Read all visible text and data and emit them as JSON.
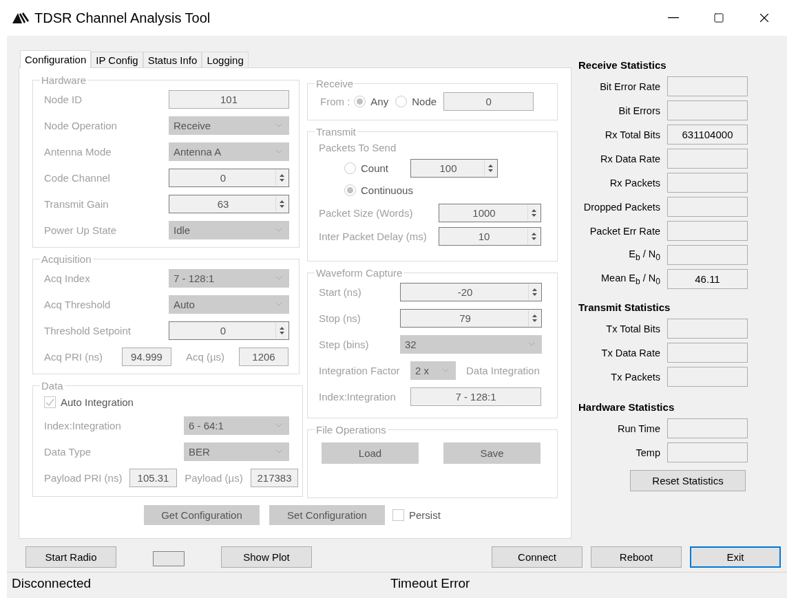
{
  "window": {
    "title": "TDSR Channel Analysis Tool"
  },
  "tabs": [
    {
      "label": "Configuration",
      "selected": true
    },
    {
      "label": "IP Config",
      "selected": false
    },
    {
      "label": "Status Info",
      "selected": false
    },
    {
      "label": "Logging",
      "selected": false
    }
  ],
  "hardware": {
    "title": "Hardware",
    "disabled": true,
    "rows": [
      {
        "kind": "text",
        "label": "Node ID",
        "value": "101"
      },
      {
        "kind": "combo",
        "label": "Node Operation",
        "value": "Receive"
      },
      {
        "kind": "combo",
        "label": "Antenna Mode",
        "value": "Antenna A"
      },
      {
        "kind": "spin",
        "label": "Code Channel",
        "value": "0"
      },
      {
        "kind": "spin",
        "label": "Transmit Gain",
        "value": "63"
      },
      {
        "kind": "combo",
        "label": "Power Up State",
        "value": "Idle"
      }
    ]
  },
  "acquisition": {
    "title": "Acquisition",
    "disabled": true,
    "rows": [
      {
        "kind": "combo",
        "label": "Acq Index",
        "value": "7 - 128:1"
      },
      {
        "kind": "combo",
        "label": "Acq Threshold",
        "value": "Auto"
      },
      {
        "kind": "spin",
        "label": "Threshold Setpoint",
        "value": "0"
      },
      {
        "kind": "pair",
        "label": "Acq PRI (ns)",
        "value": "94.999",
        "label2": "Acq (µs)",
        "value2": "1206"
      }
    ]
  },
  "data": {
    "title": "Data",
    "disabled": true,
    "auto_integration": {
      "label": "Auto Integration",
      "checked": true
    },
    "rows": [
      {
        "kind": "combo",
        "label": "Index:Integration",
        "value": "6 - 64:1"
      },
      {
        "kind": "combo",
        "label": "Data Type",
        "value": "BER"
      },
      {
        "kind": "pair",
        "label": "Payload PRI (ns)",
        "value": "105.31",
        "label2": "Payload (µs)",
        "value2": "217383"
      }
    ]
  },
  "config_buttons": [
    "Get Configuration",
    "Set Configuration"
  ],
  "persist": {
    "label": "Persist",
    "checked": false
  },
  "receive": {
    "title": "Receive",
    "disabled": true,
    "from_label": "From :",
    "options": [
      {
        "label": "Any",
        "selected": true
      },
      {
        "label": "Node",
        "selected": false
      }
    ],
    "node_value": "0"
  },
  "transmit": {
    "title": "Transmit",
    "disabled": true,
    "packets_label": "Packets To Send",
    "count": {
      "label": "Count",
      "selected": false,
      "value": "100"
    },
    "continuous": {
      "label": "Continuous",
      "selected": true
    },
    "rows": [
      {
        "kind": "spin",
        "label": "Packet Size (Words)",
        "value": "1000"
      },
      {
        "kind": "spin",
        "label": "Inter Packet Delay (ms)",
        "value": "10"
      }
    ]
  },
  "waveform_capture": {
    "title": "Waveform Capture",
    "disabled": true,
    "rows": [
      {
        "kind": "spin",
        "label": "Start (ns)",
        "value": "-20"
      },
      {
        "kind": "spin",
        "label": "Stop (ns)",
        "value": "79"
      },
      {
        "kind": "combo",
        "label": "Step (bins)",
        "value": "32"
      },
      {
        "kind": "factor",
        "label": "Integration Factor",
        "value": "2 x",
        "note": "Data Integration"
      },
      {
        "kind": "text",
        "label": "Index:Integration",
        "value": "7 - 128:1"
      }
    ]
  },
  "file_operations": {
    "title": "File Operations",
    "disabled": true,
    "buttons": [
      "Load",
      "Save"
    ]
  },
  "receive_statistics": {
    "title": "Receive Statistics",
    "rows": [
      {
        "label": "Bit Error Rate"
      },
      {
        "label": "Bit Errors"
      },
      {
        "label": "Rx Total Bits",
        "value": "631104000"
      },
      {
        "label": "Rx Data Rate"
      },
      {
        "label": "Rx Packets"
      },
      {
        "label": "Dropped Packets"
      },
      {
        "label": "Packet Err Rate"
      },
      {
        "label": "E$_{b}$ / N$_{0}$"
      },
      {
        "label": "Mean E$_{b}$ / N$_{0}$",
        "value": "46.11"
      }
    ]
  },
  "transmit_statistics": {
    "title": "Transmit Statistics",
    "rows": [
      {
        "label": "Tx Total Bits"
      },
      {
        "label": "Tx Data Rate"
      },
      {
        "label": "Tx Packets"
      }
    ]
  },
  "hardware_statistics": {
    "title": "Hardware Statistics",
    "rows": [
      {
        "label": "Run Time"
      },
      {
        "label": "Temp"
      }
    ]
  },
  "reset_button": "Reset Statistics",
  "bottom_left": [
    {
      "kind": "button",
      "label": "Start Radio"
    },
    {
      "kind": "indicator"
    },
    {
      "kind": "button",
      "label": "Show Plot"
    }
  ],
  "bottom_right": [
    {
      "label": "Connect",
      "focused": false
    },
    {
      "label": "Reboot",
      "focused": false
    },
    {
      "label": "Exit",
      "focused": true
    }
  ],
  "status_bar": [
    "Disconnected",
    "Timeout Error"
  ]
}
